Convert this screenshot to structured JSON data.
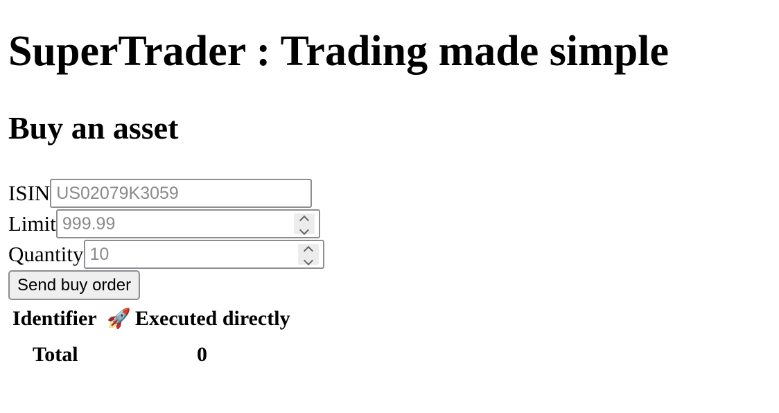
{
  "header": {
    "title": "SuperTrader : Trading made simple"
  },
  "buy_form": {
    "heading": "Buy an asset",
    "isin": {
      "label": "ISIN",
      "placeholder": "US02079K3059",
      "value": ""
    },
    "limit": {
      "label": "Limit",
      "placeholder": "999.99",
      "value": ""
    },
    "quantity": {
      "label": "Quantity",
      "placeholder": "10",
      "value": ""
    },
    "submit_label": "Send buy order"
  },
  "orders_table": {
    "columns": [
      "Identifier",
      "🚀",
      "Executed directly"
    ],
    "total_label": "Total",
    "total_value": "0"
  }
}
